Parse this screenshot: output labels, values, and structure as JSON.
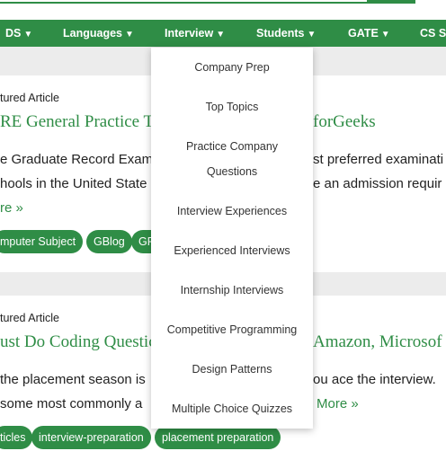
{
  "nav": {
    "items": [
      {
        "label": "DS",
        "caret": "▼"
      },
      {
        "label": "Languages",
        "caret": "▼"
      },
      {
        "label": "Interview",
        "caret": "▼"
      },
      {
        "label": "Students",
        "caret": "▼"
      },
      {
        "label": "GATE",
        "caret": "▼"
      },
      {
        "label": "CS S",
        "caret": ""
      }
    ]
  },
  "articles": [
    {
      "label": "tured Article",
      "title_left": "RE General Practice Te",
      "title_right": "forGeeks",
      "line1_left": "e Graduate Record Exam",
      "line1_right": "st preferred examinati",
      "line2_left": "hools in the United State",
      "line2_right": "e an admission requir",
      "more": "re »",
      "tags": [
        "mputer Subject",
        "GBlog",
        "GR"
      ]
    },
    {
      "label": "tured Article",
      "title_left": "ust Do Coding Questic",
      "title_right": "Amazon, Microsof",
      "line1_left": "the placement season is",
      "line1_right": "ou ace the interview.",
      "line2_left": "some most commonly a",
      "more": "More »",
      "tags": [
        "ticles",
        "interview-preparation",
        "placement preparation"
      ]
    }
  ],
  "dropdown": {
    "items": [
      "Company Prep",
      "Top Topics",
      "Practice Company",
      "Questions",
      "Interview Experiences",
      "Experienced Interviews",
      "Internship Interviews",
      "Competitive Programming",
      "Design Patterns",
      "Multiple Choice Quizzes"
    ]
  },
  "colors": {
    "brand": "#2f8d46",
    "band": "#ececec"
  }
}
